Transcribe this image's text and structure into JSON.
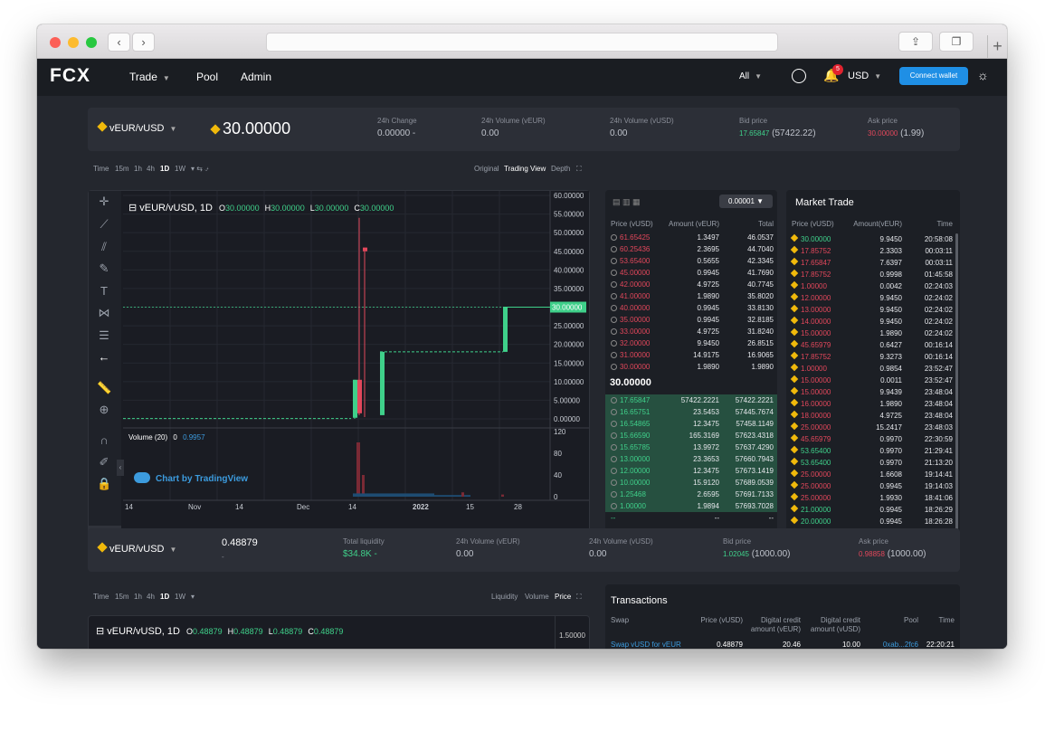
{
  "browser": {
    "url": ""
  },
  "nav": {
    "logo": "FCX",
    "items": [
      "Trade",
      "Pool",
      "Admin"
    ],
    "filter": "All",
    "notifications": "5",
    "currency": "USD",
    "connect": "Connect wallet"
  },
  "ticker": {
    "pair": "vEUR/vUSD",
    "price": "30.00000",
    "stats": [
      {
        "label": "24h Change",
        "value": "0.00000 -"
      },
      {
        "label": "24h Volume (vEUR)",
        "value": "0.00"
      },
      {
        "label": "24h Volume (vUSD)",
        "value": "0.00"
      },
      {
        "label": "Bid price",
        "value": "17.65847",
        "extra": "(57422.22)"
      },
      {
        "label": "Ask price",
        "value": "30.00000",
        "extra": "(1.99)"
      }
    ]
  },
  "chart": {
    "timeframes": [
      "Time",
      "15m",
      "1h",
      "4h",
      "1D",
      "1W"
    ],
    "active": "1D",
    "views": [
      "Original",
      "Trading View",
      "Depth"
    ],
    "view_active": "Trading View",
    "legend": {
      "pair": "vEUR/vUSD, 1D",
      "o": "30.00000",
      "h": "30.00000",
      "l": "30.00000",
      "c": "30.00000"
    },
    "price_ticks": [
      "60.00000",
      "55.00000",
      "50.00000",
      "45.00000",
      "40.00000",
      "35.00000",
      "30.00000",
      "25.00000",
      "20.00000",
      "15.00000",
      "10.00000",
      "5.00000",
      "0.00000"
    ],
    "last_price": "30.00000",
    "volume_label": "Volume (20)",
    "volume_values": [
      "0",
      "0.9957"
    ],
    "vol_ticks": [
      "120",
      "80",
      "40",
      "0"
    ],
    "x_ticks": [
      "14",
      "Nov",
      "14",
      "Dec",
      "14",
      "2022",
      "15",
      "28"
    ],
    "watermark": "Chart by TradingView"
  },
  "orderbook": {
    "precision": "0.00001",
    "headers": [
      "Price (vUSD)",
      "Amount (vEUR)",
      "Total"
    ],
    "mid": "30.00000",
    "asks": [
      [
        "61.65425",
        "1.3497",
        "46.0537"
      ],
      [
        "60.25436",
        "2.3695",
        "44.7040"
      ],
      [
        "53.65400",
        "0.5655",
        "42.3345"
      ],
      [
        "45.00000",
        "0.9945",
        "41.7690"
      ],
      [
        "42.00000",
        "4.9725",
        "40.7745"
      ],
      [
        "41.00000",
        "1.9890",
        "35.8020"
      ],
      [
        "40.00000",
        "0.9945",
        "33.8130"
      ],
      [
        "35.00000",
        "0.9945",
        "32.8185"
      ],
      [
        "33.00000",
        "4.9725",
        "31.8240"
      ],
      [
        "32.00000",
        "9.9450",
        "26.8515"
      ],
      [
        "31.00000",
        "14.9175",
        "16.9065"
      ],
      [
        "30.00000",
        "1.9890",
        "1.9890"
      ]
    ],
    "bids": [
      [
        "17.65847",
        "57422.2221",
        "57422.2221"
      ],
      [
        "16.65751",
        "23.5453",
        "57445.7674"
      ],
      [
        "16.54865",
        "12.3475",
        "57458.1149"
      ],
      [
        "15.66590",
        "165.3169",
        "57623.4318"
      ],
      [
        "15.65785",
        "13.9972",
        "57637.4290"
      ],
      [
        "13.00000",
        "23.3653",
        "57660.7943"
      ],
      [
        "12.00000",
        "12.3475",
        "57673.1419"
      ],
      [
        "10.00000",
        "15.9120",
        "57689.0539"
      ],
      [
        "1.25468",
        "2.6595",
        "57691.7133"
      ],
      [
        "1.00000",
        "1.9894",
        "57693.7028"
      ],
      [
        "--",
        "--",
        "--"
      ],
      [
        "--",
        "--",
        "--"
      ]
    ]
  },
  "market_trade": {
    "title": "Market Trade",
    "headers": [
      "Price (vUSD)",
      "Amount(vEUR)",
      "Time"
    ],
    "rows": [
      [
        "30.00000",
        "9.9450",
        "20:58:08",
        "g"
      ],
      [
        "17.85752",
        "2.3303",
        "00:03:11",
        "r"
      ],
      [
        "17.65847",
        "7.6397",
        "00:03:11",
        "r"
      ],
      [
        "17.85752",
        "0.9998",
        "01:45:58",
        "r"
      ],
      [
        "1.00000",
        "0.0042",
        "02:24:03",
        "r"
      ],
      [
        "12.00000",
        "9.9450",
        "02:24:02",
        "r"
      ],
      [
        "13.00000",
        "9.9450",
        "02:24:02",
        "r"
      ],
      [
        "14.00000",
        "9.9450",
        "02:24:02",
        "r"
      ],
      [
        "15.00000",
        "1.9890",
        "02:24:02",
        "r"
      ],
      [
        "45.65979",
        "0.6427",
        "00:16:14",
        "r"
      ],
      [
        "17.85752",
        "9.3273",
        "00:16:14",
        "r"
      ],
      [
        "1.00000",
        "0.9854",
        "23:52:47",
        "r"
      ],
      [
        "15.00000",
        "0.0011",
        "23:52:47",
        "r"
      ],
      [
        "15.00000",
        "9.9439",
        "23:48:04",
        "r"
      ],
      [
        "16.00000",
        "1.9890",
        "23:48:04",
        "r"
      ],
      [
        "18.00000",
        "4.9725",
        "23:48:04",
        "r"
      ],
      [
        "25.00000",
        "15.2417",
        "23:48:03",
        "r"
      ],
      [
        "45.65979",
        "0.9970",
        "22:30:59",
        "r"
      ],
      [
        "53.65400",
        "0.9970",
        "21:29:41",
        "g"
      ],
      [
        "53.65400",
        "0.9970",
        "21:13:20",
        "g"
      ],
      [
        "25.00000",
        "1.6608",
        "19:14:41",
        "r"
      ],
      [
        "25.00000",
        "0.9945",
        "19:14:03",
        "r"
      ],
      [
        "25.00000",
        "1.9930",
        "18:41:06",
        "r"
      ],
      [
        "21.00000",
        "0.9945",
        "18:26:29",
        "g"
      ],
      [
        "20.00000",
        "0.9945",
        "18:26:28",
        "g"
      ],
      [
        "1.00000",
        "0.0044",
        "00:21:26",
        "r"
      ]
    ]
  },
  "pool": {
    "pair": "vEUR/vUSD",
    "price": "0.48879",
    "sub": "-",
    "stats": [
      {
        "label": "Total liquidity",
        "value": "$34.8K -"
      },
      {
        "label": "24h Volume (vEUR)",
        "value": "0.00"
      },
      {
        "label": "24h Volume (vUSD)",
        "value": "0.00"
      },
      {
        "label": "Bid price",
        "value": "1.02045",
        "extra": "(1000.00)"
      },
      {
        "label": "Ask price",
        "value": "0.98858",
        "extra": "(1000.00)"
      }
    ]
  },
  "chart2": {
    "timeframes": [
      "Time",
      "15m",
      "1h",
      "4h",
      "1D",
      "1W"
    ],
    "active": "1D",
    "views": [
      "Liquidity",
      "Volume",
      "Price"
    ],
    "view_active": "Price",
    "legend": {
      "pair": "vEUR/vUSD, 1D",
      "o": "0.48879",
      "h": "0.48879",
      "l": "0.48879",
      "c": "0.48879"
    },
    "tick": "1.50000"
  },
  "transactions": {
    "title": "Transactions",
    "headers": [
      "Swap",
      "Price (vUSD)",
      "Digital credit amount (vEUR)",
      "Digital credit amount (vUSD)",
      "Pool",
      "Time"
    ],
    "row": [
      "Swap vUSD for vEUR",
      "0.48879",
      "20.46",
      "10.00",
      "0xab...2fc6",
      "22:20:21"
    ]
  },
  "colors": {
    "green": "#3fd08a",
    "red": "#e2475b",
    "accent": "#1f8fe5"
  }
}
